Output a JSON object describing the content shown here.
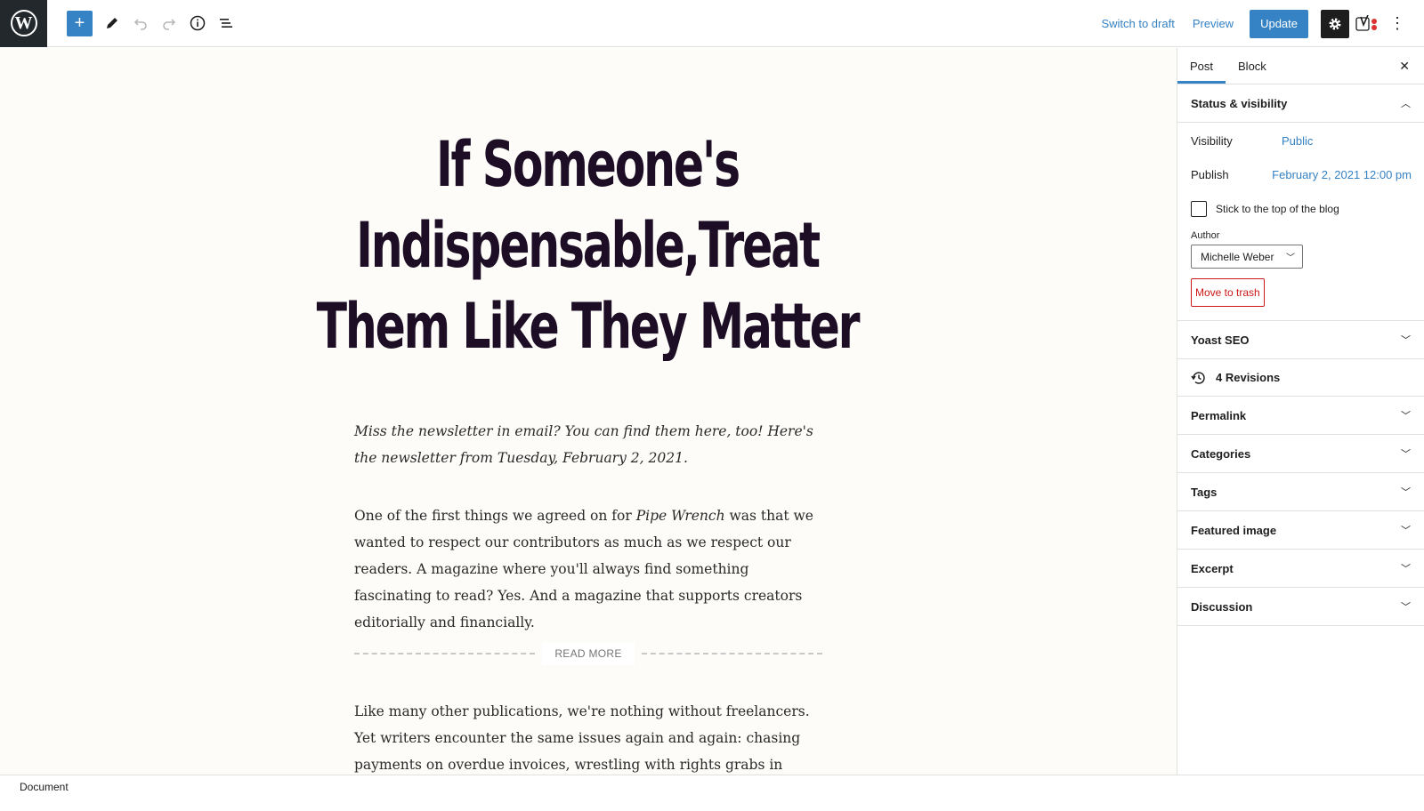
{
  "toolbar": {
    "logo_letter": "W",
    "switch_to_draft": "Switch to draft",
    "preview": "Preview",
    "update": "Update",
    "icons": [
      "wordpress-logo",
      "plus-icon",
      "pencil-icon",
      "undo-icon",
      "redo-icon",
      "info-icon",
      "list-view-icon",
      "gear-icon",
      "yoast-icon",
      "more-vertical-icon"
    ]
  },
  "post": {
    "title": "If Someone's Indispensable,Treat Them Like They Matter",
    "intro": "Miss the newsletter in email? You can find them here, too! Here's the newsletter from Tuesday, February 2, 2021.",
    "p1_before": "One of the first things we agreed on for ",
    "p1_em": "Pipe Wrench",
    "p1_after": " was that we wanted to respect our contributors as much as we respect our readers. A magazine where you'll always find something fascinating to read? Yes. And a magazine that supports creators editorially and financially.",
    "read_more": "READ MORE",
    "p2": "Like many other publications, we're nothing without freelancers. Yet writers encounter the same issues again and again: chasing payments on overdue invoices, wrestling with rights grabs in contracts, hustling"
  },
  "sidebar": {
    "tabs": [
      "Post",
      "Block"
    ],
    "status": {
      "heading": "Status & visibility",
      "visibility_label": "Visibility",
      "visibility_value": "Public",
      "publish_label": "Publish",
      "publish_value": "February 2, 2021 12:00 pm",
      "stick_label": "Stick to the top of the blog",
      "author_label": "Author",
      "author_value": "Michelle Weber",
      "trash": "Move to trash"
    },
    "yoast": "Yoast SEO",
    "revisions": "4 Revisions",
    "panels": [
      "Permalink",
      "Categories",
      "Tags",
      "Featured image",
      "Excerpt",
      "Discussion"
    ]
  },
  "footer": {
    "breadcrumb": "Document"
  },
  "colors": {
    "accent": "#3582c4",
    "title": "#1d0e25",
    "danger": "#cc1818",
    "canvas": "#fdfcf9"
  }
}
